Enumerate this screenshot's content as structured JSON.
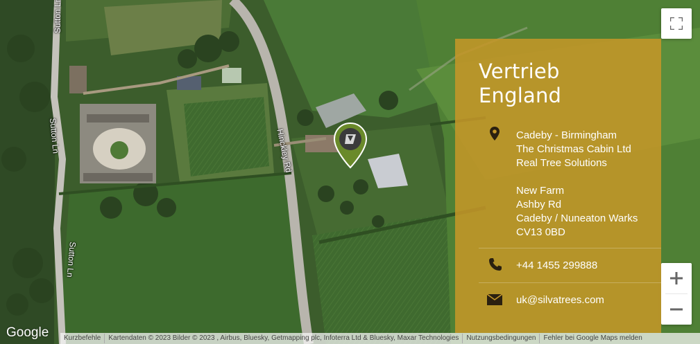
{
  "map": {
    "roads": [
      {
        "id": "sutton-lane-top",
        "name": "Sutton Ln"
      },
      {
        "id": "sutton-lane-mid",
        "name": "Sutton Ln"
      },
      {
        "id": "sutton-lane-bottom",
        "name": "Sutton Ln"
      },
      {
        "id": "hinckley-road",
        "name": "Hinckley Rd"
      }
    ],
    "marker": {
      "icon": "location-pin-icon",
      "color": "#6a8a2a"
    }
  },
  "info": {
    "title": "Vertrieb England",
    "address_lines": [
      "Cadeby - Birmingham",
      "The Christmas Cabin Ltd",
      "Real Tree Solutions"
    ],
    "address_lines_2": [
      "New Farm",
      "Ashby Rd",
      "Cadeby / Nuneaton Warks",
      "CV13 0BD"
    ],
    "phone": "+44 1455 299888",
    "email": "uk@silvatrees.com",
    "icons": {
      "address": "map-marker-icon",
      "phone": "phone-icon",
      "email": "envelope-icon"
    },
    "panel_color": "#c49628"
  },
  "controls": {
    "fullscreen_icon": "fullscreen-icon",
    "zoom_in": "+",
    "zoom_out": "−"
  },
  "footer": {
    "logo": "Google",
    "shortcuts": "Kurzbefehle",
    "map_data": "Kartendaten © 2023 Bilder © 2023 , Airbus, Bluesky, Getmapping plc, Infoterra Ltd & Bluesky, Maxar Technologies",
    "terms": "Nutzungsbedingungen",
    "report": "Fehler bei Google Maps melden"
  }
}
